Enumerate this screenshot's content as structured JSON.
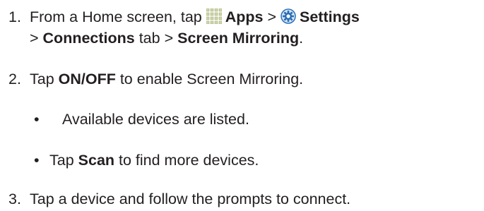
{
  "steps": [
    {
      "number": "1.",
      "line1": {
        "t1": "From a Home screen, tap ",
        "apps_label": "Apps",
        "sep1": " > ",
        "settings_label": "Settings"
      },
      "line2": {
        "sep2": "> ",
        "connections_label": "Connections",
        "t2": " tab > ",
        "mirroring_label": "Screen Mirroring",
        "end": "."
      }
    },
    {
      "number": "2.",
      "t1": "Tap ",
      "onoff_label": "ON/OFF",
      "t2": " to enable Screen Mirroring.",
      "bullets": [
        {
          "symbol": "•",
          "text": "Available devices are listed."
        },
        {
          "symbol": "•",
          "t1": "Tap ",
          "scan_label": "Scan",
          "t2": " to find more devices."
        }
      ]
    },
    {
      "number": "3.",
      "text": "Tap a device and follow the prompts to connect."
    }
  ],
  "icons": {
    "apps": "apps-grid-icon",
    "settings": "gear-icon"
  },
  "colors": {
    "text": "#231f20",
    "apps_icon": "#cfd6a9",
    "settings_icon": "#2a6fb5"
  }
}
